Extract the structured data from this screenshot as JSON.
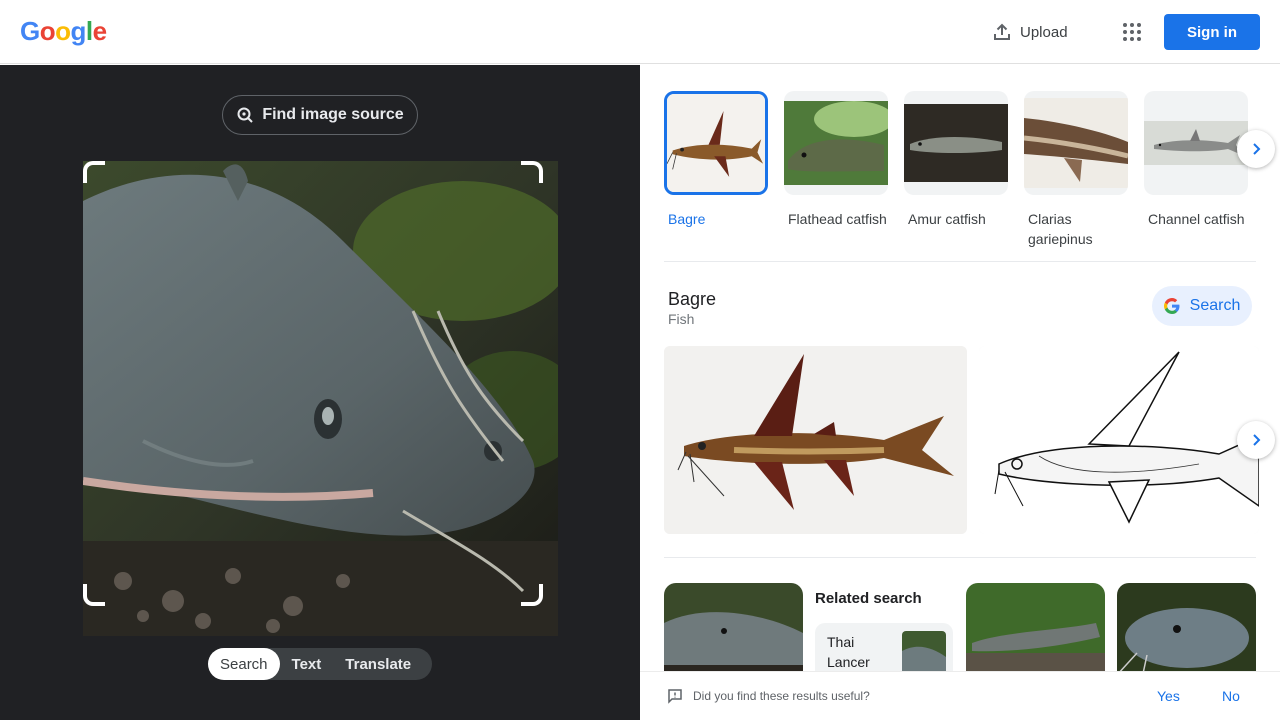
{
  "header": {
    "logo_letters": [
      "G",
      "o",
      "o",
      "g",
      "l",
      "e"
    ],
    "upload_label": "Upload",
    "apps_icon": "apps-grid-icon",
    "signin_label": "Sign in"
  },
  "lens": {
    "find_source_label": "Find image source",
    "modes": [
      "Search",
      "Text",
      "Translate"
    ],
    "active_mode": "Search"
  },
  "visual_matches": [
    {
      "label": "Bagre",
      "selected": true
    },
    {
      "label": "Flathead catfish",
      "selected": false
    },
    {
      "label": "Amur catfish",
      "selected": false
    },
    {
      "label": "Clarias gariepinus",
      "selected": false
    },
    {
      "label": "Channel catfish",
      "selected": false
    }
  ],
  "entity": {
    "title": "Bagre",
    "subtitle": "Fish",
    "search_label": "Search"
  },
  "related": {
    "title": "Related search",
    "chip_label": "Thai Lancer"
  },
  "feedback": {
    "question": "Did you find these results useful?",
    "yes_label": "Yes",
    "no_label": "No"
  },
  "colors": {
    "accent": "#1a73e8",
    "dark_panel": "#202124"
  }
}
